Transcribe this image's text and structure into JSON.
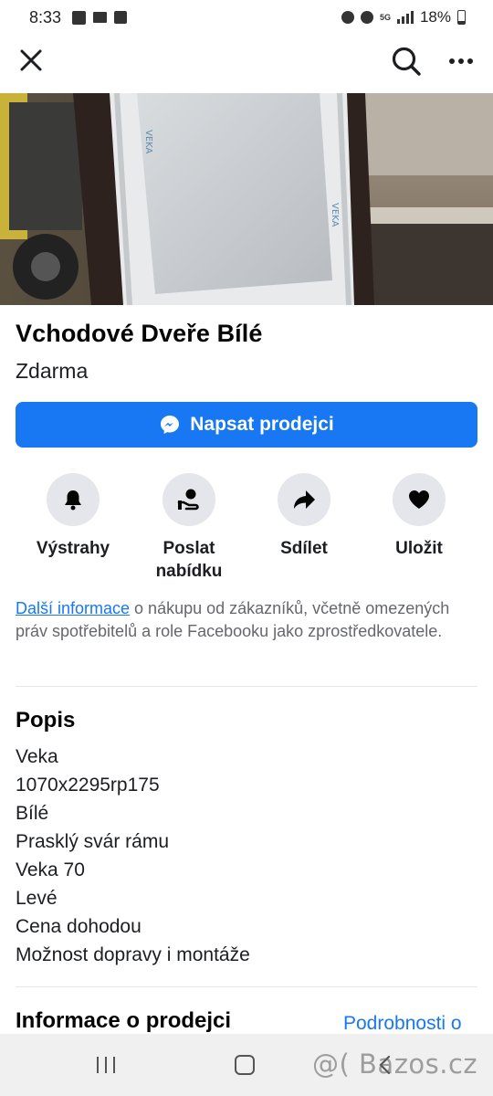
{
  "status_bar": {
    "time": "8:33",
    "network": "5G",
    "battery": "18%"
  },
  "top_bar": {
    "close_icon": "close-icon",
    "search_icon": "search-icon",
    "more_icon": "more-horizontal-icon"
  },
  "listing": {
    "title": "Vchodové Dveře Bílé",
    "price": "Zdarma",
    "message_button": "Napsat prodejci"
  },
  "actions": [
    {
      "icon": "bell-icon",
      "label": "Výstrahy"
    },
    {
      "icon": "offer-icon",
      "label": "Poslat nabídku"
    },
    {
      "icon": "share-icon",
      "label": "Sdílet"
    },
    {
      "icon": "heart-icon",
      "label": "Uložit"
    }
  ],
  "info": {
    "link": "Další informace",
    "text": " o nákupu od zákazníků, včetně omezených práv spotřebitelů a role Facebooku jako zprostředkovatele."
  },
  "description": {
    "heading": "Popis",
    "lines": [
      "Veka",
      "1070x2295rp175",
      "Bílé",
      "Prasklý svár rámu",
      "Veka 70",
      "Levé",
      "Cena dohodou",
      "Možnost dopravy i montáže"
    ]
  },
  "seller": {
    "heading": "Informace o prodejci",
    "details_link": "Podrobnosti o"
  },
  "watermark": "@( Bazos.cz",
  "colors": {
    "accent": "#1877f2",
    "action_bg": "#e4e6eb",
    "secondary_text": "#65676b"
  }
}
